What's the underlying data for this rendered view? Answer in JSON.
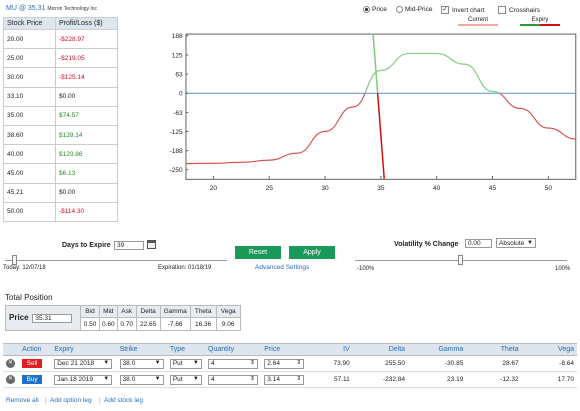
{
  "ticker": {
    "symbol": "MU @ 35.31",
    "name": "Micron Technology Inc"
  },
  "pl_table": {
    "headers": [
      "Stock Price",
      "Profit/Loss ($)"
    ],
    "rows": [
      {
        "price": "20.00",
        "pl": "-$228.97",
        "status": "loss"
      },
      {
        "price": "25.00",
        "pl": "-$219.05",
        "status": "loss"
      },
      {
        "price": "30.00",
        "pl": "-$125.14",
        "status": "loss"
      },
      {
        "price": "33.10",
        "pl": "$0.00",
        "status": "zero"
      },
      {
        "price": "35.00",
        "pl": "$74.57",
        "status": "gain"
      },
      {
        "price": "38.60",
        "pl": "$139.14",
        "status": "gain"
      },
      {
        "price": "40.00",
        "pl": "$129.86",
        "status": "gain"
      },
      {
        "price": "45.00",
        "pl": "$6.13",
        "status": "gain"
      },
      {
        "price": "45.21",
        "pl": "$0.00",
        "status": "zero"
      },
      {
        "price": "50.00",
        "pl": "-$114.30",
        "status": "loss"
      }
    ]
  },
  "chart_options": {
    "price": "Price",
    "mid_price": "Mid-Price",
    "invert_chart": "Invert chart",
    "crosshairs": "Crosshairs",
    "selected": "price",
    "invert_checked": true,
    "crosshairs_checked": false
  },
  "legend": {
    "current": "Current",
    "expiry": "Expiry"
  },
  "colors": {
    "current": "#d94a4a",
    "expiry_a": "#2a9a3a",
    "expiry_b": "#d01010",
    "zero_line": "#5a8fd6",
    "accent_green": "#1a9a5a"
  },
  "chart_data": {
    "type": "line",
    "x_ticks": [
      20,
      25,
      30,
      35,
      40,
      45,
      50
    ],
    "y_ticks": [
      188,
      125,
      63,
      0,
      -63,
      -125,
      -188,
      -250
    ],
    "xlim": [
      17.5,
      52.5
    ],
    "ylim": [
      -280,
      195
    ],
    "series": [
      {
        "name": "Current",
        "x": [
          17.5,
          20,
          22.5,
          25,
          27.5,
          30,
          32.5,
          35,
          37.5,
          40,
          42.5,
          45,
          47.5,
          50,
          52.5
        ],
        "y": [
          -230,
          -229,
          -226,
          -219,
          -196,
          -125,
          -45,
          75,
          130,
          130,
          95,
          6,
          -50,
          -114,
          -150
        ]
      },
      {
        "name": "Expiry",
        "x": [
          34.3,
          35.3
        ],
        "y": [
          195,
          -280
        ]
      }
    ]
  },
  "expiry_controls": {
    "label": "Days to Expire",
    "value": "39",
    "today": "Today: 12/07/18",
    "expiration": "Expiration: 01/18/19"
  },
  "buttons": {
    "reset": "Reset",
    "apply": "Apply",
    "advanced": "Advanced Settings"
  },
  "volatility": {
    "label": "Volatility % Change",
    "value": "0.00",
    "mode": "Absolute",
    "min": "-100%",
    "max": "100%",
    "position": 0.5
  },
  "day_slider_position": 0.0,
  "total_position": {
    "title": "Total Position",
    "price_label": "Price",
    "price_value": "35.31",
    "headers": [
      "Bid",
      "Mid",
      "Ask",
      "Delta",
      "Gamma",
      "Theta",
      "Vega"
    ],
    "values": [
      "0.50",
      "0.60",
      "0.70",
      "22.65",
      "-7.66",
      "16.36",
      "9.06"
    ]
  },
  "legs": {
    "headers": [
      "Action",
      "Expiry",
      "Strike",
      "Type",
      "Quantity",
      "Price",
      "IV",
      "Delta",
      "Gamma",
      "Theta",
      "Vega"
    ],
    "rows": [
      {
        "action": "Sell",
        "expiry": "Dec 21 2018",
        "strike": "38.0",
        "type": "Put",
        "qty": "4",
        "price": "2.64",
        "iv": "73.90",
        "delta": "255.50",
        "gamma": "-30.85",
        "theta": "28.67",
        "vega": "-8.64"
      },
      {
        "action": "Buy",
        "expiry": "Jan 18 2019",
        "strike": "38.0",
        "type": "Put",
        "qty": "4",
        "price": "3.14",
        "iv": "57.11",
        "delta": "-232.84",
        "gamma": "23.19",
        "theta": "-12.32",
        "vega": "17.70"
      }
    ]
  },
  "footer_links": {
    "remove_all": "Remove all",
    "add_option": "Add option leg",
    "add_stock": "Add stock leg"
  }
}
